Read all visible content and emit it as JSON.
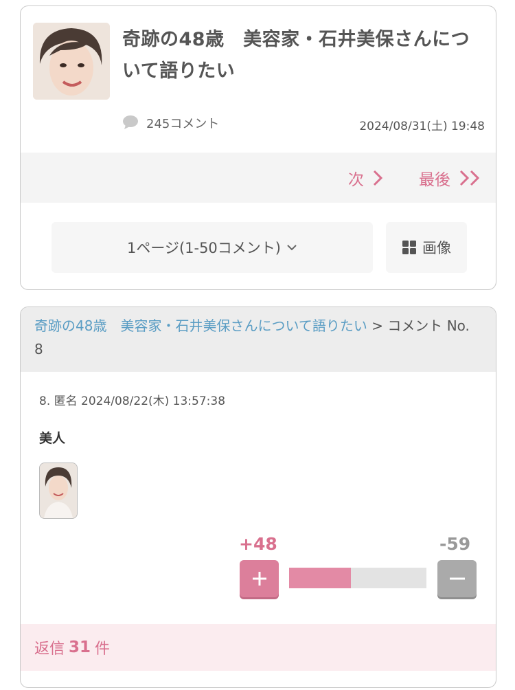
{
  "topic": {
    "title": "奇跡の48歳　美容家・石井美保さんについて語りたい",
    "comments_label": "245コメント",
    "date": "2024/08/31(土) 19:48",
    "pager": {
      "next_label": "次",
      "last_label": "最後"
    },
    "page_select_label": "1ページ(1-50コメント)",
    "image_button_label": "画像"
  },
  "comment": {
    "breadcrumb": {
      "topic_link": "奇跡の48歳　美容家・石井美保さんについて語りたい",
      "separator": " > ",
      "current": "コメント No. 8"
    },
    "header": "8. 匿名 2024/08/22(木) 13:57:38",
    "body": "美人",
    "votes": {
      "plus_label": "+48",
      "minus_label": "-59",
      "plus": 48,
      "minus": 59
    },
    "reply": {
      "prefix": "返信",
      "count": "31",
      "suffix": "件"
    }
  },
  "colors": {
    "accent_pink": "#d9708e",
    "link_blue": "#5a9dc4",
    "minus_gray": "#aaaaaa"
  }
}
